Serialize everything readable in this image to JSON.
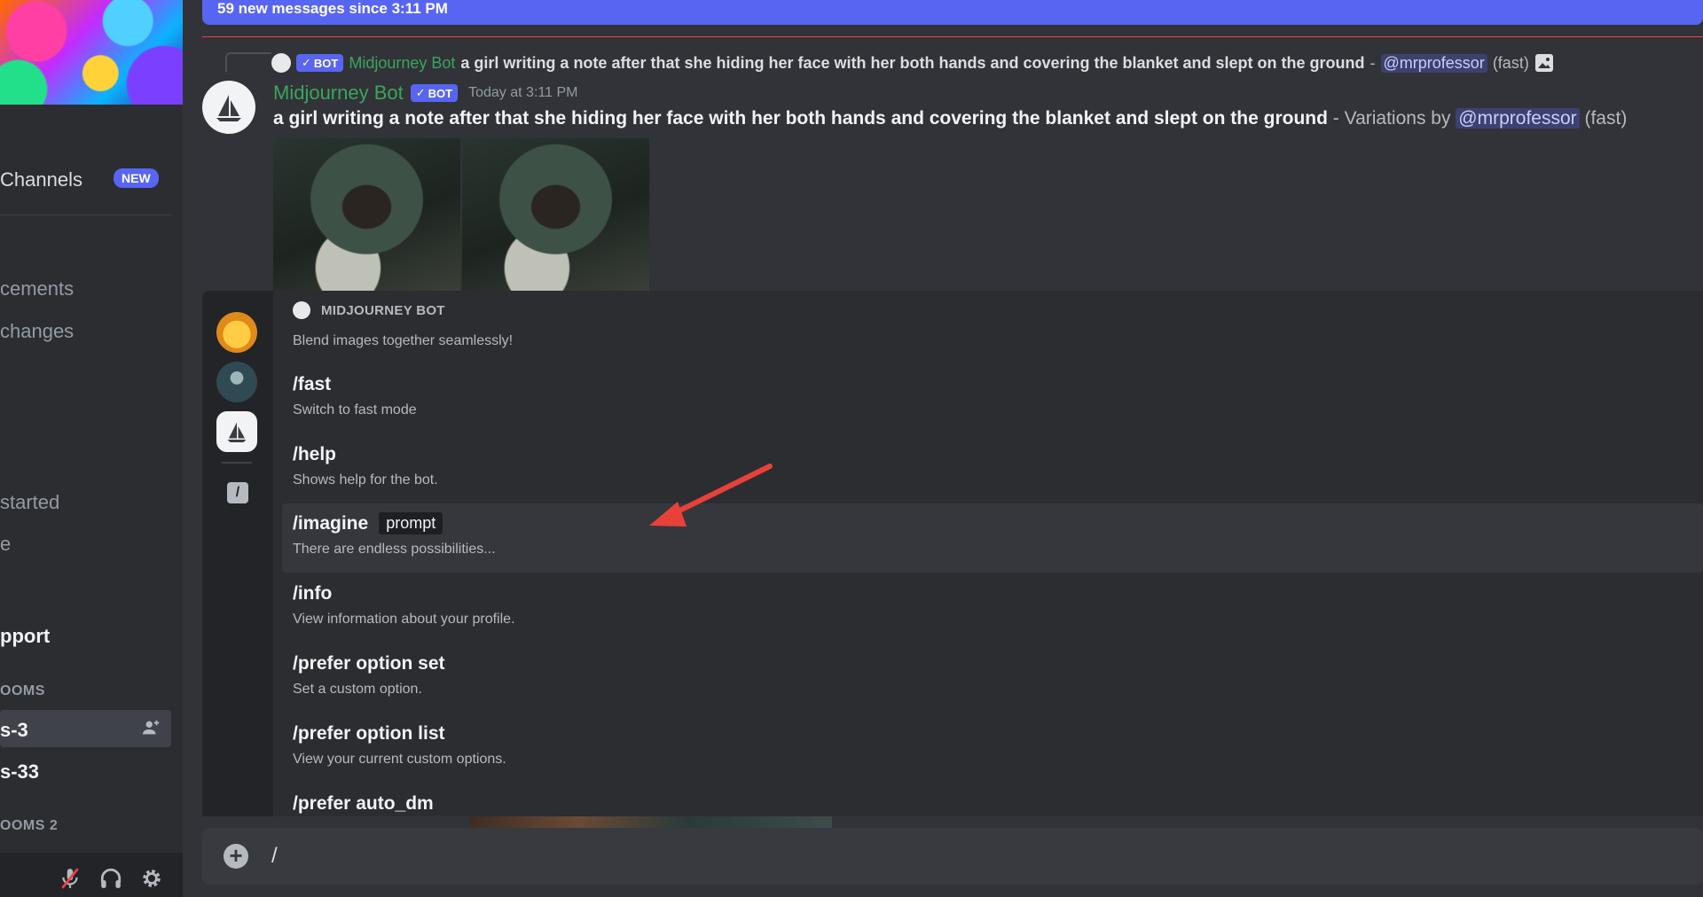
{
  "sidebar": {
    "channels_label": "Channels",
    "new_badge": "NEW",
    "items": [
      {
        "label": "cements"
      },
      {
        "label": "changes"
      },
      {
        "label": "started"
      },
      {
        "label": "e"
      },
      {
        "label": "pport"
      }
    ],
    "category_1": "OOMS",
    "rooms": [
      {
        "label": "s-3"
      },
      {
        "label": "s-33"
      }
    ],
    "category_2": "OOMS 2"
  },
  "banner": {
    "new_messages": "59 new messages since 3:11 PM"
  },
  "reply": {
    "bot_tag": "BOT",
    "author": "Midjourney Bot",
    "text": "a girl writing a note after that she hiding her face with her both hands and covering the blanket and slept on the ground",
    "separator": " - ",
    "mention": "@mrprofessor",
    "mode": "(fast)"
  },
  "message": {
    "author": "Midjourney Bot",
    "bot_tag": "BOT",
    "timestamp": "Today at 3:11 PM",
    "prompt": "a girl writing a note after that she hiding her face with her both hands and covering the blanket and slept on the ground",
    "variation_text": " - Variations by ",
    "mention": "@mrprofessor",
    "mode": "(fast)"
  },
  "command_popup": {
    "bot_header": "MIDJOURNEY BOT",
    "blend_description": "Blend images together seamlessly!",
    "commands": [
      {
        "name": "/fast",
        "description": "Switch to fast mode"
      },
      {
        "name": "/help",
        "description": "Shows help for the bot."
      },
      {
        "name": "/imagine",
        "option": "prompt",
        "description": "There are endless possibilities..."
      },
      {
        "name": "/info",
        "description": "View information about your profile."
      },
      {
        "name": "/prefer option set",
        "description": "Set a custom option."
      },
      {
        "name": "/prefer option list",
        "description": "View your current custom options."
      },
      {
        "name": "/prefer auto_dm",
        "description": ""
      }
    ]
  },
  "input": {
    "value": "/"
  },
  "colors": {
    "accent": "#5865f2",
    "bot_green": "#3ba55c",
    "annotation_arrow": "#e8413a"
  }
}
